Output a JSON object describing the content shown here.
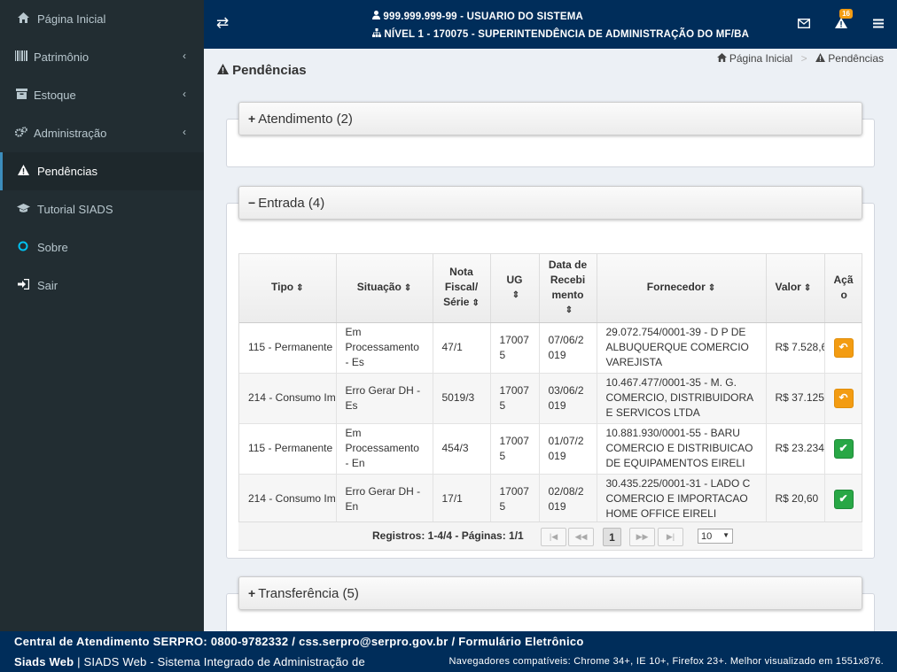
{
  "sidebar": {
    "items": [
      {
        "label": "Página Inicial",
        "icon": "home-icon"
      },
      {
        "label": "Patrimônio",
        "icon": "barcode-icon"
      },
      {
        "label": "Estoque",
        "icon": "archive-icon"
      },
      {
        "label": "Administração",
        "icon": "gears-icon"
      },
      {
        "label": "Pendências",
        "icon": "warning-icon"
      },
      {
        "label": "Tutorial SIADS",
        "icon": "graduation-cap-icon"
      },
      {
        "label": "Sobre",
        "icon": "circle-icon"
      },
      {
        "label": "Sair",
        "icon": "sign-out-icon"
      }
    ]
  },
  "header": {
    "user_line": "999.999.999-99 - USUARIO DO SISTEMA",
    "level_line": "NÍVEL 1 - 170075 - SUPERINTENDÊNCIA DE ADMINISTRAÇÃO DO MF/BA",
    "notification_count": "16"
  },
  "page": {
    "title": "Pendências",
    "breadcrumb_home": "Página Inicial",
    "breadcrumb_sep": ">",
    "breadcrumb_current": "Pendências"
  },
  "panels": {
    "atendimento": "Atendimento (2)",
    "entrada": "Entrada (4)",
    "transferencia": "Transferência (5)"
  },
  "table": {
    "headers": {
      "tipo": "Tipo",
      "situacao": "Situação",
      "nota_l1": "Nota",
      "nota_l2": "Fiscal/",
      "nota_l3": "Série",
      "ug": "UG",
      "data_l1": "Data de",
      "data_l2": "Recebi",
      "data_l3": "mento",
      "fornecedor": "Fornecedor",
      "valor": "Valor",
      "acao_l1": "Açã",
      "acao_l2": "o"
    },
    "rows": [
      {
        "tipo": "115 - Permanente",
        "sit1": "Em",
        "sit2": "Processamento",
        "sit3": "- Es",
        "nota": "47/1",
        "ug1": "17007",
        "ug2": "5",
        "data1": "07/06/2",
        "data2": "019",
        "forn1": "29.072.754/0001-39 - D P DE",
        "forn2": "ALBUQUERQUE COMERCIO",
        "forn3": "VAREJISTA",
        "valor": "R$ 7.528,6",
        "acao": "reply-icon"
      },
      {
        "tipo": "214 - Consumo Im",
        "sit1": "Erro Gerar DH -",
        "sit2": "Es",
        "sit3": "",
        "nota": "5019/3",
        "ug1": "17007",
        "ug2": "5",
        "data1": "03/06/2",
        "data2": "019",
        "forn1": "10.467.477/0001-35 - M. G.",
        "forn2": "COMERCIO, DISTRIBUIDORA",
        "forn3": "E SERVICOS LTDA",
        "valor": "R$ 37.125",
        "acao": "reply-icon"
      },
      {
        "tipo": "115 - Permanente",
        "sit1": "Em",
        "sit2": "Processamento",
        "sit3": "- En",
        "nota": "454/3",
        "ug1": "17007",
        "ug2": "5",
        "data1": "01/07/2",
        "data2": "019",
        "forn1": "10.881.930/0001-55 - BARU",
        "forn2": "COMERCIO E DISTRIBUICAO",
        "forn3": "DE EQUIPAMENTOS EIRELI",
        "valor": "R$ 23.234",
        "acao": "check-icon"
      },
      {
        "tipo": "214 - Consumo Im",
        "sit1": "Erro Gerar DH -",
        "sit2": "En",
        "sit3": "",
        "nota": "17/1",
        "ug1": "17007",
        "ug2": "5",
        "data1": "02/08/2",
        "data2": "019",
        "forn1": "30.435.225/0001-31 - LADO C",
        "forn2": "COMERCIO E IMPORTACAO",
        "forn3": "HOME OFFICE EIRELI",
        "valor": "R$ 20,60",
        "acao": "check-icon"
      }
    ]
  },
  "pager": {
    "text": "Registros: 1-4/4 - Páginas: 1/1",
    "current_page": "1",
    "page_size": "10"
  },
  "footer": {
    "line1": "Central de Atendimento SERPRO: 0800-9782332 / css.serpro@serpro.gov.br / Formulário Eletrônico",
    "brand": "Siads Web",
    "line2": " | SIADS Web - Sistema Integrado de Administração de",
    "browsers": "Navegadores compatíveis: Chrome 34+, IE 10+, Firefox 23+. Melhor visualizado em 1551x876."
  },
  "colors": {
    "sidebar_bg": "#222d32",
    "header_bg": "#002d5a",
    "accent": "#3c8dbc",
    "warning": "#f39c12",
    "success": "#28a745"
  }
}
